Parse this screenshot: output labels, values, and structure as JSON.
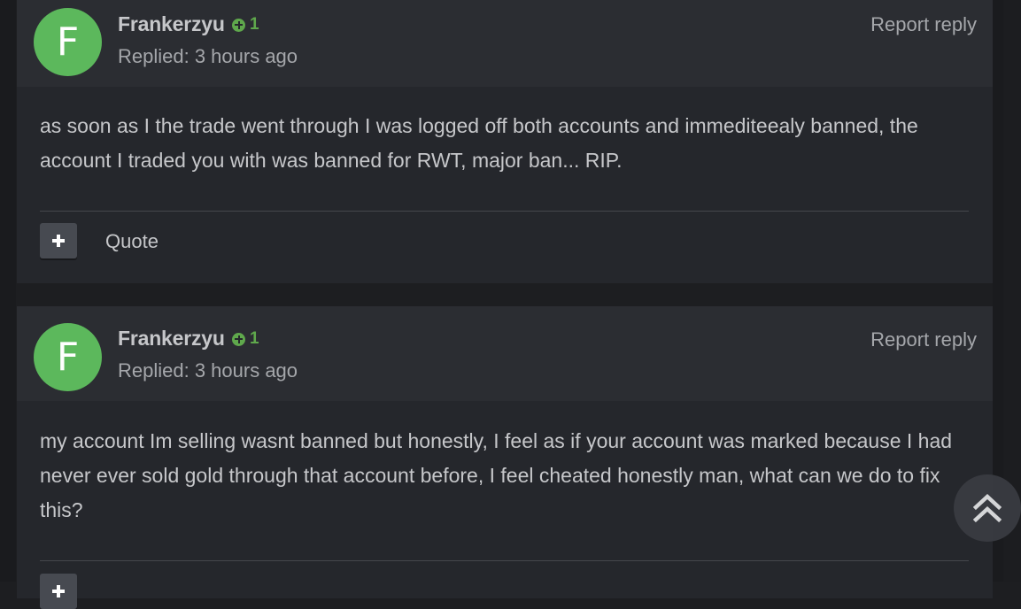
{
  "posts": [
    {
      "avatar_letter": "F",
      "author": "Frankerzyu",
      "reputation": "1",
      "replied": "Replied: 3 hours ago",
      "report_label": "Report reply",
      "body": "as soon as I the trade went through I was logged off both accounts and immediteealy banned, the account I traded you with was banned for RWT, major ban... RIP.",
      "quote_label": "Quote"
    },
    {
      "avatar_letter": "F",
      "author": "Frankerzyu",
      "reputation": "1",
      "replied": "Replied: 3 hours ago",
      "report_label": "Report reply",
      "body": "my account Im selling wasnt banned but honestly, I feel as if your account was marked because I had never ever sold gold through that account before, I feel cheated honestly man, what can we do to fix this?"
    }
  ],
  "icons": {
    "reputation": "plus-circle-icon",
    "multiquote": "plus-icon",
    "scroll_top": "double-chevron-up-icon"
  },
  "colors": {
    "avatar_bg": "#5cb85c",
    "reputation": "#5fa84c",
    "post_bg": "#25272c",
    "header_bg": "#2b2d32"
  }
}
